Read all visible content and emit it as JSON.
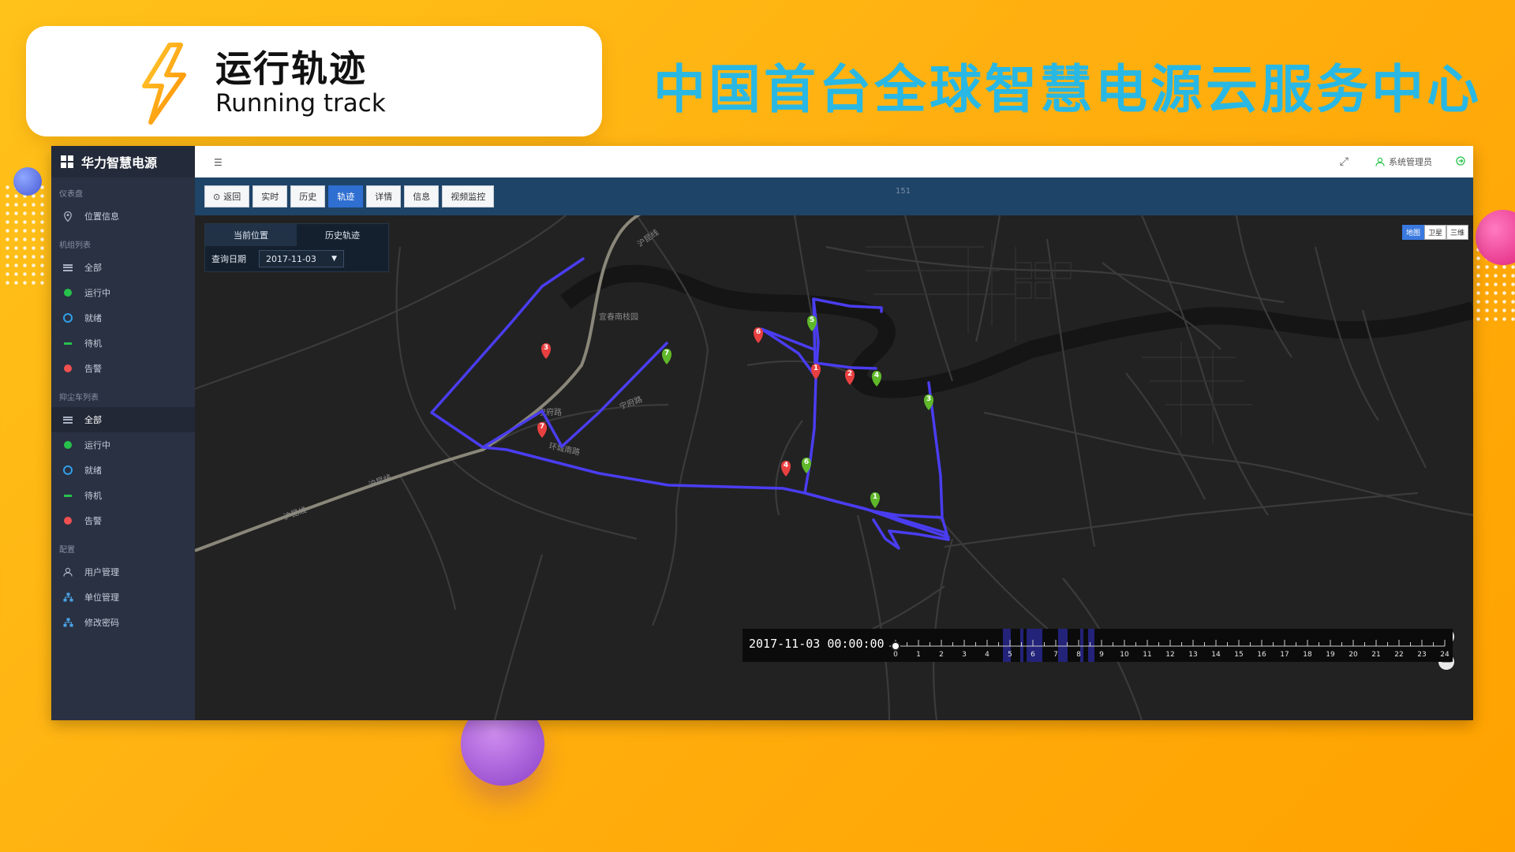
{
  "header": {
    "title_cn": "运行轨迹",
    "title_en": "Running track",
    "slogan": "中国首台全球智慧电源云服务中心"
  },
  "sidebar": {
    "brand": "华力智慧电源",
    "sections": [
      {
        "title": "仪表盘",
        "items": [
          {
            "label": "位置信息",
            "icon": "location-pin-icon"
          }
        ]
      },
      {
        "title": "机组列表",
        "items": [
          {
            "label": "全部",
            "icon": "list-icon"
          },
          {
            "label": "运行中",
            "icon": "green-dot-icon"
          },
          {
            "label": "就绪",
            "icon": "blue-ring-icon"
          },
          {
            "label": "待机",
            "icon": "green-dash-icon"
          },
          {
            "label": "告警",
            "icon": "red-dot-icon"
          }
        ]
      },
      {
        "title": "抑尘车列表",
        "items": [
          {
            "label": "全部",
            "icon": "list-icon",
            "active": true
          },
          {
            "label": "运行中",
            "icon": "green-dot-icon"
          },
          {
            "label": "就绪",
            "icon": "blue-ring-icon"
          },
          {
            "label": "待机",
            "icon": "green-dash-icon"
          },
          {
            "label": "告警",
            "icon": "red-dot-icon"
          }
        ]
      },
      {
        "title": "配置",
        "items": [
          {
            "label": "用户管理",
            "icon": "user-icon"
          },
          {
            "label": "单位管理",
            "icon": "org-icon"
          },
          {
            "label": "修改密码",
            "icon": "key-icon"
          }
        ]
      }
    ]
  },
  "topbar": {
    "user": "系统管理员",
    "icons": [
      "expand-icon",
      "user-icon",
      "logout-icon"
    ]
  },
  "toolbar": {
    "buttons": [
      "返回",
      "实时",
      "历史",
      "轨迹",
      "详情",
      "信息",
      "视频监控"
    ],
    "active": "轨迹",
    "road_number": "151"
  },
  "panel": {
    "tabs": [
      "当前位置",
      "历史轨迹"
    ],
    "date_label": "查询日期",
    "date_value": "2017-11-03"
  },
  "map": {
    "types": [
      "地图",
      "卫星",
      "三维"
    ],
    "active_type": "地图",
    "labels": [
      "宜春南枝园",
      "宁府路",
      "宁府路",
      "环城南路",
      "沪昆线",
      "沪昆线",
      "沪昆线"
    ],
    "markers": [
      {
        "n": "3",
        "color": "#e84040"
      },
      {
        "n": "7",
        "color": "#5fb82a"
      },
      {
        "n": "7",
        "color": "#e84040"
      },
      {
        "n": "6",
        "color": "#e84040"
      },
      {
        "n": "5",
        "color": "#5fb82a"
      },
      {
        "n": "1",
        "color": "#e84040"
      },
      {
        "n": "2",
        "color": "#e84040"
      },
      {
        "n": "4",
        "color": "#5fb82a"
      },
      {
        "n": "3",
        "color": "#5fb82a"
      },
      {
        "n": "4",
        "color": "#e84040"
      },
      {
        "n": "6",
        "color": "#5fb82a"
      },
      {
        "n": "1",
        "color": "#5fb82a"
      }
    ],
    "route_color": "#4a3df0"
  },
  "timeline": {
    "time": "2017-11-03 00:00:00",
    "hours": [
      "0",
      "1",
      "2",
      "3",
      "4",
      "5",
      "6",
      "7",
      "8",
      "9",
      "10",
      "11",
      "12",
      "13",
      "14",
      "15",
      "16",
      "17",
      "18",
      "19",
      "20",
      "21",
      "22",
      "23",
      "24"
    ]
  },
  "colors": {
    "background": "#ffb010",
    "slogan": "#29b8e3",
    "sidebar": "#2a3142",
    "toolbar": "#1e4468",
    "active_button": "#2f6fd1"
  }
}
